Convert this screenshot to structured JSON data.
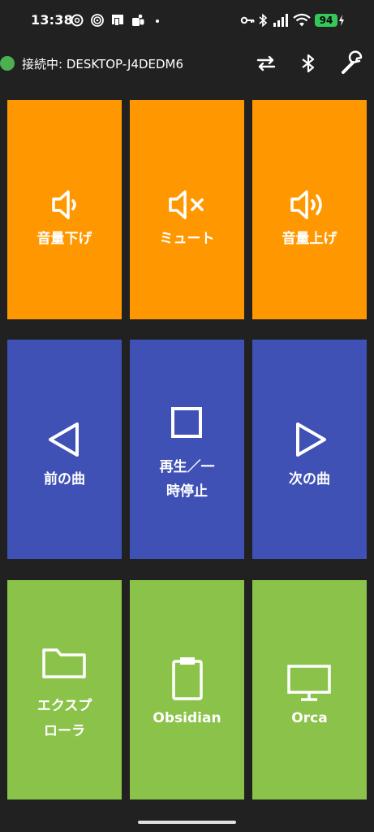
{
  "status_bar": {
    "time": "13:38",
    "battery": "94"
  },
  "app_bar": {
    "connection_text": "接続中: DESKTOP-J4DEDM6",
    "status_color": "#4caf50"
  },
  "tiles": [
    {
      "label": "音量下げ",
      "icon": "volume-down-icon",
      "color": "#ff9800"
    },
    {
      "label": "ミュート",
      "icon": "volume-mute-icon",
      "color": "#ff9800"
    },
    {
      "label": "音量上げ",
      "icon": "volume-up-icon",
      "color": "#ff9800"
    },
    {
      "label": "前の曲",
      "icon": "previous-track-icon",
      "color": "#3f51b5"
    },
    {
      "label_line1": "再生／一",
      "label_line2": "時停止",
      "icon": "stop-icon",
      "color": "#3f51b5"
    },
    {
      "label": "次の曲",
      "icon": "next-track-icon",
      "color": "#3f51b5"
    },
    {
      "label_line1": "エクスプ",
      "label_line2": "ローラ",
      "icon": "folder-icon",
      "color": "#8bc34a"
    },
    {
      "label": "Obsidian",
      "icon": "clipboard-icon",
      "color": "#8bc34a"
    },
    {
      "label": "Orca",
      "icon": "monitor-icon",
      "color": "#8bc34a"
    }
  ]
}
